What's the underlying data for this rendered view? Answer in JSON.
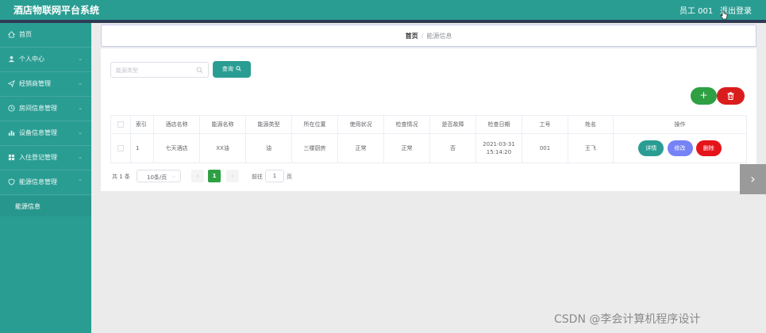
{
  "header": {
    "app_title": "酒店物联网平台系统",
    "user_label": "员工 001",
    "logout_label": "退出登录"
  },
  "sidebar": {
    "items": [
      {
        "label": "首页",
        "icon": "home-icon"
      },
      {
        "label": "个人中心",
        "icon": "user-icon"
      },
      {
        "label": "经销商管理",
        "icon": "send-icon"
      },
      {
        "label": "房间信息管理",
        "icon": "clock-icon"
      },
      {
        "label": "设备信息管理",
        "icon": "chart-icon"
      },
      {
        "label": "入住登记管理",
        "icon": "grid-icon"
      },
      {
        "label": "能源信息管理",
        "icon": "shield-icon"
      }
    ],
    "subitem": {
      "label": "能源信息"
    }
  },
  "breadcrumb": {
    "home": "首页",
    "separator": "/",
    "current": "能源信息"
  },
  "search": {
    "placeholder": "能源类型",
    "query_label": "查询"
  },
  "actions": {
    "add_symbol": "+"
  },
  "table": {
    "columns": [
      "索引",
      "酒店名称",
      "能源名称",
      "能源类型",
      "所在位置",
      "使用状况",
      "检查情况",
      "是否故障",
      "检查日期",
      "工号",
      "姓名",
      "操作"
    ],
    "rows": [
      {
        "index": "1",
        "hotel": "七天酒店",
        "energy_name": "XX油",
        "energy_type": "油",
        "location": "三楼厨房",
        "usage": "正常",
        "inspection": "正常",
        "fault": "否",
        "check_date": "2021-03-31",
        "check_time": "15:14:20",
        "staff_no": "001",
        "name": "王飞"
      }
    ],
    "row_actions": {
      "detail": "详情",
      "edit": "修改",
      "delete": "删除"
    }
  },
  "pagination": {
    "total": "共 1 条",
    "page_size": "10条/页",
    "current_page": "1",
    "goto_label": "前往",
    "goto_value": "1",
    "page_unit": "页"
  },
  "watermark": "CSDN @李会计算机程序设计",
  "colors": {
    "primary": "#2a9d93",
    "add": "#2ea043",
    "danger": "#d91d1d",
    "edit": "#7682f5"
  }
}
